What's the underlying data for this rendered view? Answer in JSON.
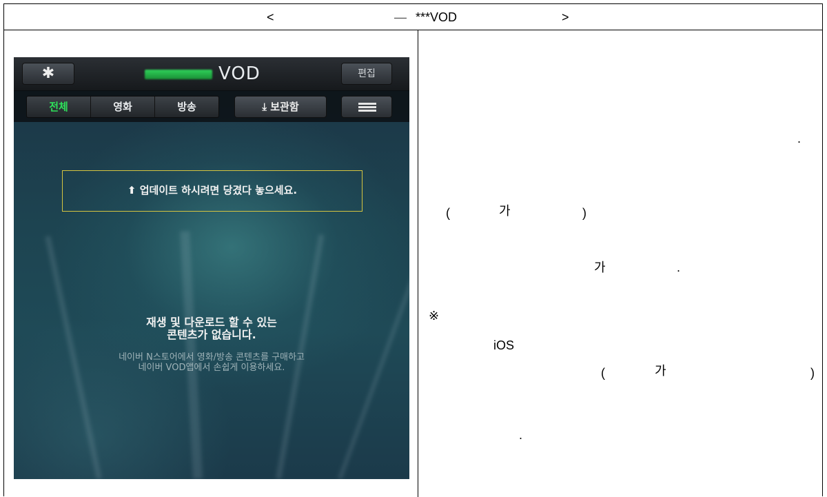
{
  "header": {
    "left_bracket": "<",
    "dash": "—",
    "title": "***VOD",
    "right_bracket": ">"
  },
  "phone": {
    "title": "VOD",
    "settings_icon": "gear-icon",
    "edit_label": "편집",
    "tabs": [
      {
        "label": "전체",
        "active": true
      },
      {
        "label": "영화",
        "active": false
      },
      {
        "label": "방송",
        "active": false
      }
    ],
    "storage_icon": "download-icon",
    "storage_label": "보관함",
    "menu_icon": "hamburger-menu-icon",
    "update_icon": "up-arrow-icon",
    "update_text": "업데이트 하시려면 당겼다 놓으세요.",
    "empty_line1": "재생 및 다운로드 할 수 있는",
    "empty_line2": "콘텐츠가 없습니다.",
    "empty_sub1": "네이버 N스토어에서 영화/방송 콘텐츠를 구매하고",
    "empty_sub2": "네이버 VOD앱에서 손쉽게 이용하세요.",
    "colors": {
      "active_tab": "#2ee05a",
      "update_border": "#d6c540"
    }
  },
  "right_panel": {
    "t1": ".",
    "t2": "(",
    "t3": "가",
    "t4": ")",
    "t5": "가",
    "t6": ".",
    "t7": "※",
    "t8": "iOS",
    "t9": "(",
    "t10": "가",
    "t11": ")",
    "t12": "."
  }
}
